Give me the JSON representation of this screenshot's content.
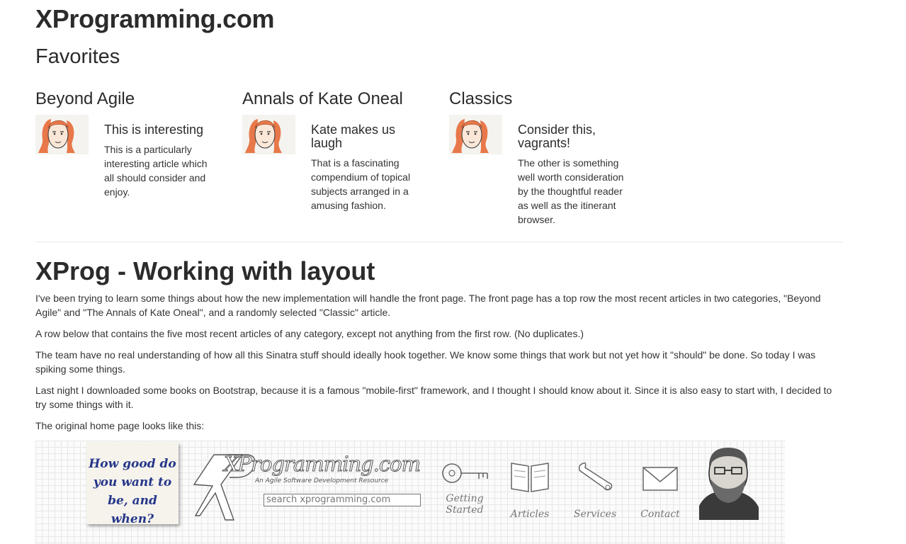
{
  "site": {
    "title": "XProgramming.com"
  },
  "favorites": {
    "heading": "Favorites",
    "columns": [
      {
        "category": "Beyond Agile",
        "article_title": "This is interesting",
        "summary": "This is a particularly interesting article which all should consider and enjoy."
      },
      {
        "category": "Annals of Kate Oneal",
        "article_title": "Kate makes us laugh",
        "summary": "That is a fascinating compendium of topical subjects arranged in a amusing fashion."
      },
      {
        "category": "Classics",
        "article_title": "Consider this, vagrants!",
        "summary": "The other is something well worth consideration by the thoughtful reader as well as the itinerant browser."
      }
    ]
  },
  "post": {
    "title": "XProg - Working with layout",
    "paragraphs": [
      "I've been trying to learn some things about how the new implementation will handle the front page. The front page has a top row the most recent articles in two categories, \"Beyond Agile\" and \"The Annals of Kate Oneal\", and a randomly selected \"Classic\" article.",
      "A row below that contains the five most recent articles of any category, except not anything from the first row. (No duplicates.)",
      "The team have no real understanding of how all this Sinatra stuff should ideally hook together. We know some things that work but not yet how it \"should\" be done. So today I was spiking some things.",
      "Last night I downloaded some books on Bootstrap, because it is a famous \"mobile-first\" framework, and I thought I should know about it. Since it is also easy to start with, I decided to try some things with it.",
      "The original home page looks like this:"
    ]
  },
  "banner": {
    "sticky_note": "How good do you want to be, and when?",
    "logo_text": "XProgramming.com",
    "logo_subtitle": "An Agile Software Development Resource",
    "search_placeholder": "search xprogramming.com",
    "nav": [
      {
        "label": "Getting Started",
        "icon": "key-icon"
      },
      {
        "label": "Articles",
        "icon": "book-icon"
      },
      {
        "label": "Services",
        "icon": "wrench-icon"
      },
      {
        "label": "Contact",
        "icon": "envelope-icon"
      }
    ]
  }
}
